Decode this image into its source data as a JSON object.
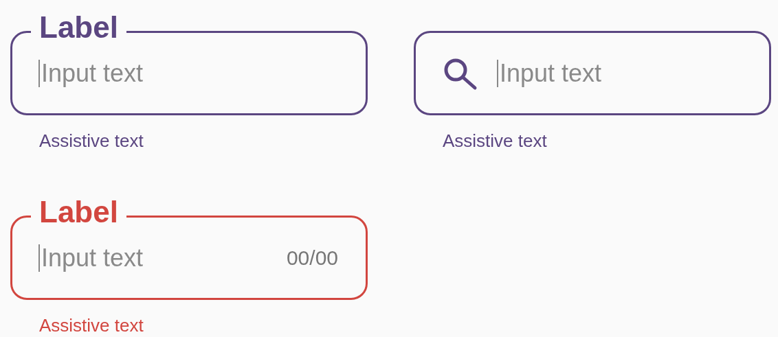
{
  "fields": [
    {
      "kind": "outlined",
      "error": false,
      "label": "Label",
      "placeholder": "Input text",
      "assistive": "Assistive text"
    },
    {
      "kind": "search",
      "error": false,
      "placeholder": "Input text",
      "assistive": "Assistive text"
    },
    {
      "kind": "outlined",
      "error": true,
      "label": "Label",
      "placeholder": "Input text",
      "counter": "00/00",
      "assistive": "Assistive text"
    }
  ]
}
